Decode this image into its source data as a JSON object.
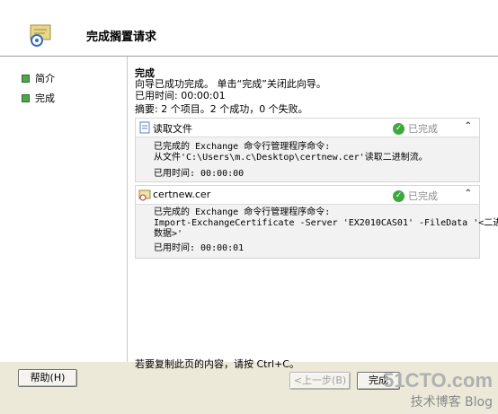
{
  "header": {
    "title": "完成搁置请求"
  },
  "sidebar": {
    "items": [
      {
        "label": "简介"
      },
      {
        "label": "完成"
      }
    ]
  },
  "main": {
    "title": "完成",
    "lines": [
      "向导已成功完成。 单击“完成”关闭此向导。",
      "已用时间: 00:00:01",
      "摘要: 2 个项目。2 个成功，0 个失败。"
    ],
    "panels": [
      {
        "name": "读取文件",
        "status": "已完成",
        "text": "已完成的 Exchange 命令行管理程序命令:\n从文件'C:\\Users\\m.c\\Desktop\\certnew.cer'读取二进制流。",
        "elapsed": "已用时间: 00:00:00"
      },
      {
        "name": "certnew.cer",
        "status": "已完成",
        "text": "已完成的 Exchange 命令行管理程序命令:\nImport-ExchangeCertificate -Server 'EX2010CAS01' -FileData '<二进制\n数据>'",
        "elapsed": "已用时间: 00:00:01"
      }
    ]
  },
  "hint": "若要复制此页的内容，请按 Ctrl+C。",
  "buttons": {
    "help": "帮助(H)",
    "back": "<上一步(B)",
    "finish": "完成"
  },
  "watermark": {
    "top": "51CTO.com",
    "bottom": "技术博客 Blog"
  }
}
